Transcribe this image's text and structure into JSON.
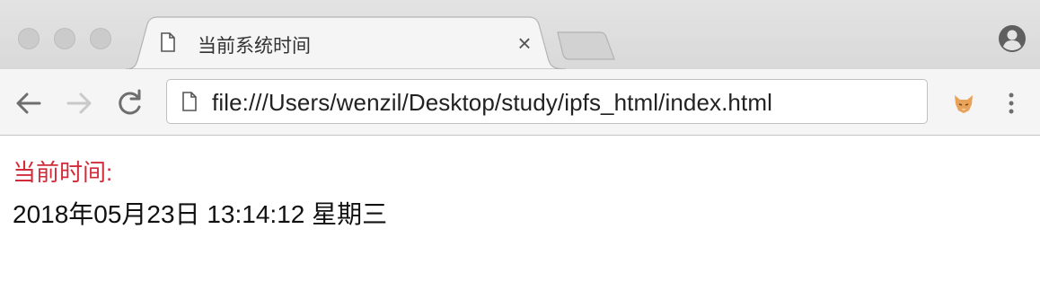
{
  "browser": {
    "tab": {
      "title": "当前系统时间",
      "close_glyph": "×",
      "icon": "document-icon"
    },
    "omnibox": {
      "url": "file:///Users/wenzil/Desktop/study/ipfs_html/index.html",
      "icon": "document-icon"
    },
    "toolbar_icons": [
      "back-arrow-icon",
      "forward-arrow-icon",
      "reload-icon",
      "extension-fox-icon",
      "menu-kebab-icon"
    ],
    "profile_icon": "profile-icon"
  },
  "page": {
    "label": "当前时间:",
    "datetime": "2018年05月23日 13:14:12 星期三"
  },
  "colors": {
    "label": "#d22b3a",
    "text": "#111111",
    "tabstrip": "#dddddd",
    "toolbar": "#f5f5f5"
  }
}
